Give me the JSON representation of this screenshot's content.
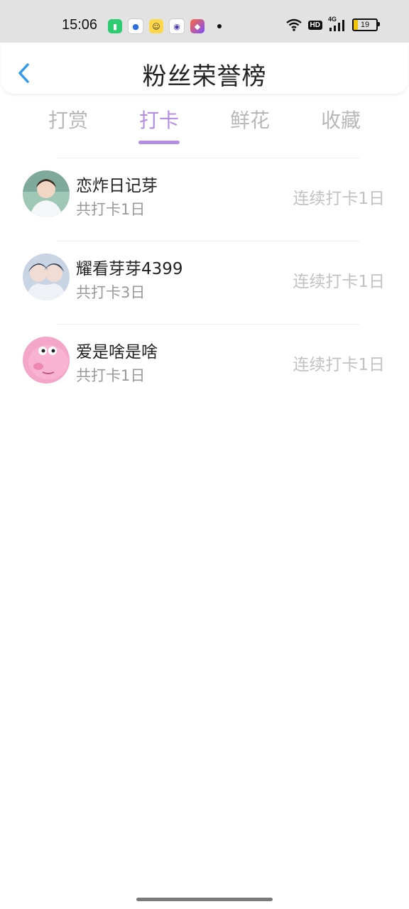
{
  "status_bar": {
    "time": "15:06",
    "network": "4G",
    "hd_label": "HD",
    "battery": "19",
    "battery_level": 0.19
  },
  "header": {
    "title": "粉丝荣誉榜"
  },
  "tabs": [
    {
      "label": "打赏",
      "active": false
    },
    {
      "label": "打卡",
      "active": true
    },
    {
      "label": "鲜花",
      "active": false
    },
    {
      "label": "收藏",
      "active": false
    }
  ],
  "fans": [
    {
      "name": "恋炸日记芽",
      "total": "共打卡1日",
      "streak": "连续打卡1日"
    },
    {
      "name": "耀看芽芽4399",
      "total": "共打卡3日",
      "streak": "连续打卡1日"
    },
    {
      "name": "爱是啥是啥",
      "total": "共打卡1日",
      "streak": "连续打卡1日"
    }
  ],
  "colors": {
    "accent": "#b48ee5",
    "back_icon": "#2f9bea"
  }
}
